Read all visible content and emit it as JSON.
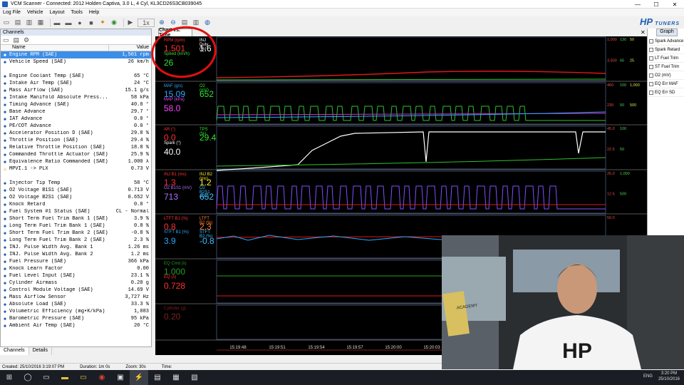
{
  "window": {
    "title": "VCM Scanner - Connected: 2012 Holden Captiva, 3.0 L, 4 Cyl, KL3CD26S3CB039045",
    "min": "—",
    "max": "☐",
    "close": "✕"
  },
  "menu": [
    "Log File",
    "Vehicle",
    "Layout",
    "Tools",
    "Help"
  ],
  "toolbar_icons": [
    "open-icon",
    "save-icon",
    "save-as-icon",
    "print-icon",
    "vehicle-icon",
    "connect-icon",
    "record-icon",
    "stop-icon",
    "bug-icon",
    "scan-icon",
    "play-icon",
    "speed-icon",
    "zoom-in-icon",
    "zoom-out-icon",
    "layout-icon",
    "save-layout-icon",
    "help-icon"
  ],
  "brand": {
    "name": "HP",
    "sub": "TUNERS"
  },
  "channels": {
    "header": "Channels",
    "col_name": "Name",
    "col_value": "Value",
    "rows": [
      {
        "name": "Engine RPM (SAE)",
        "value": "1,501 rpm",
        "selected": true
      },
      {
        "name": "Vehicle Speed (SAE)",
        "value": "26 km/h"
      },
      {
        "gap": true
      },
      {
        "name": "Engine Coolant Temp (SAE)",
        "value": "65 °C"
      },
      {
        "name": "Intake Air Temp (SAE)",
        "value": "24 °C"
      },
      {
        "name": "Mass Airflow (SAE)",
        "value": "15.1 g/s"
      },
      {
        "name": "Intake Manifold Absolute Press...",
        "value": "58 kPa"
      },
      {
        "name": "Timing Advance (SAE)",
        "value": "40.0 °"
      },
      {
        "name": "Base Advance",
        "value": "29.7 °"
      },
      {
        "name": "IAT Advance",
        "value": "0.0 °"
      },
      {
        "name": "PE/COT Advance",
        "value": "0.0 °"
      },
      {
        "name": "Accelerator Position D (SAE)",
        "value": "29.8 %"
      },
      {
        "name": "Throttle Position (SAE)",
        "value": "29.4 %"
      },
      {
        "name": "Relative Throttle Position (SAE)",
        "value": "18.8 %"
      },
      {
        "name": "Commanded Throttle Actuator (SAE)",
        "value": "25.9 %"
      },
      {
        "name": "Equivalence Ratio Commanded (SAE)",
        "value": "1.000 λ"
      },
      {
        "name": "MPVI.1 -> PLX",
        "value": "0.73 V",
        "warn": true
      },
      {
        "gap": true
      },
      {
        "name": "Injector Tip Temp",
        "value": "58 °C"
      },
      {
        "name": "O2 Voltage B1S1 (SAE)",
        "value": "0.713 V"
      },
      {
        "name": "O2 Voltage B2S1 (SAE)",
        "value": "0.652 V"
      },
      {
        "name": "Knock Retard",
        "value": "0.0 °"
      },
      {
        "name": "Fuel System #1 Status (SAE)",
        "value": "CL - Normal"
      },
      {
        "name": "Short Term Fuel Trim Bank 1 (SAE)",
        "value": "3.9 %"
      },
      {
        "name": "Long Term Fuel Trim Bank 1 (SAE)",
        "value": "0.8 %"
      },
      {
        "name": "Short Term Fuel Trim Bank 2 (SAE)",
        "value": "-0.8 %"
      },
      {
        "name": "Long Term Fuel Trim Bank 2 (SAE)",
        "value": "2.3 %"
      },
      {
        "name": "INJ. Pulse Width Avg. Bank 1",
        "value": "1.26 ms"
      },
      {
        "name": "INJ. Pulse Width Avg. Bank 2",
        "value": "1.2 ms"
      },
      {
        "name": "Fuel Pressure (SAE)",
        "value": "366 kPa"
      },
      {
        "name": "Knock Learn Factor",
        "value": "0.00"
      },
      {
        "name": "Fuel Level Input (SAE)",
        "value": "23.1 %"
      },
      {
        "name": "Cylinder Airmass",
        "value": "0.20 g"
      },
      {
        "name": "Control Module Voltage (SAE)",
        "value": "14.69 V"
      },
      {
        "name": "Mass Airflow Sensor",
        "value": "3,727 Hz"
      },
      {
        "name": "Absolute Load (SAE)",
        "value": "33.3 %"
      },
      {
        "name": "Volumetric Efficiency (mg•K/kPa)",
        "value": "1,083"
      },
      {
        "name": "Barometric Pressure (SAE)",
        "value": "95 kPa"
      },
      {
        "name": "Ambient Air Temp (SAE)",
        "value": "20 °C"
      }
    ],
    "tabs": [
      "Channels",
      "Details"
    ]
  },
  "chart": {
    "tab": "Chart vs. Time",
    "gauges": [
      {
        "l1": "RPM (rpm)",
        "v1": "1,501",
        "c1": "#ff3030",
        "l2": "INJ Duty (%)",
        "v2": "1.6",
        "c2": "#ffffff",
        "l3": "Speed (km/h)",
        "v3": "26",
        "c3": "#30e030"
      },
      {
        "l1": "MAF (g/s)",
        "v1": "15.09",
        "c1": "#2aa8ff",
        "l2": "O2 (mV)",
        "v2": "652",
        "c2": "#30e030",
        "l3": "MAP (kPa)",
        "v3": "58.0",
        "c3": "#ff40ff"
      },
      {
        "l1": "AR (°)",
        "v1": "0.0",
        "c1": "#ff3030",
        "l2": "TPS (%)",
        "v2": "29.4",
        "c2": "#30e030",
        "l3": "Spark (°)",
        "v3": "40.0",
        "c3": "#ffffff"
      },
      {
        "l1": "INJ B1 (ms)",
        "v1": "1.3",
        "c1": "#ff3030",
        "l2": "INJ B2 (ms)",
        "v2": "1.2",
        "c2": "#ffee30",
        "l3": "O2 B1S1 (mV)",
        "v3": "713",
        "c3": "#b070ff",
        "l4": "O2 B2S1 (mV)",
        "v4": "652",
        "c4": "#40c0ff"
      },
      {
        "l1": "LTFT B1 (%)",
        "v1": "0.8",
        "c1": "#ff3030",
        "l2": "LTFT B2 (%)",
        "v2": "2.3",
        "c2": "#ff8030",
        "l3": "STFT B1 (%)",
        "v3": "3.9",
        "c3": "#2aa8ff",
        "l4": "STFT B2 (%)",
        "v4": "-0.8",
        "c4": "#40c0ff"
      },
      {
        "l1": "EQ Cmd (λ)",
        "v1": "1.000",
        "c1": "#20a020",
        "l3": "EQ (λ)",
        "v3": "0.728",
        "c3": "#ff3030"
      },
      {
        "l1": "Cylinder (g)",
        "v1": "0.20",
        "c1": "#802020"
      }
    ],
    "right_scales": [
      {
        "a": "1,000",
        "b": "130",
        "c": "50",
        "d": "3,500",
        "e": "65",
        "f": "25"
      },
      {
        "a": "460",
        "b": "100",
        "c": "1,000",
        "d": "230",
        "e": "50",
        "f": "500"
      },
      {
        "a": "45.0",
        "b": "100",
        "d": "22.5",
        "e": "50"
      },
      {
        "a": "25.0",
        "b": "1,000",
        "d": "12.5",
        "e": "500"
      },
      {
        "a": "50.0"
      },
      {
        "a": "1.000"
      },
      {
        "a": "1.00"
      }
    ],
    "times": [
      "15:19:48",
      "15:19:51",
      "15:19:54",
      "15:19:57",
      "15:20:00",
      "15:20:03"
    ]
  },
  "graph_panel": {
    "tab": "Graph",
    "items": [
      "Spark Advance",
      "Spark Retard",
      "LT Fuel Trim",
      "ST Fuel Trim",
      "O2 (mV)",
      "EQ Err MAF",
      "EQ Err SD"
    ]
  },
  "status": {
    "created": "Created: 25/10/2016 3:19:07 PM",
    "duration": "Duration: 1m 0s",
    "zoom": "Zoom: 30s",
    "time": "Time:"
  },
  "taskbar": {
    "lang": "ENG",
    "time": "3:20 PM",
    "date": "25/10/2016"
  },
  "webcam": {
    "shirt": "HP",
    "poster": "ACADEMY"
  }
}
